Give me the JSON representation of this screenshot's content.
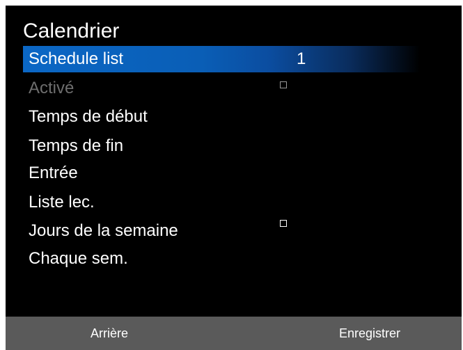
{
  "title": "Calendrier",
  "menu": {
    "items": [
      {
        "label": "Schedule list",
        "value": "1",
        "selected": true
      },
      {
        "label": "Activé",
        "checked": false,
        "disabled": true
      },
      {
        "label": "Temps de début"
      },
      {
        "label": "Temps de fin"
      },
      {
        "label": "Entrée"
      },
      {
        "label": "Liste lec."
      },
      {
        "label": "Jours de la semaine",
        "checked": false
      },
      {
        "label": "Chaque sem."
      }
    ]
  },
  "footer": {
    "back_label": "Arrière",
    "save_label": "Enregistrer"
  },
  "colors": {
    "background": "#000000",
    "selection_blue": "#0b67c5",
    "footer_bar": "#5a5a5a",
    "disabled_text": "#6e6e6e"
  },
  "icons": {
    "checkbox": "checkbox-empty-icon"
  }
}
